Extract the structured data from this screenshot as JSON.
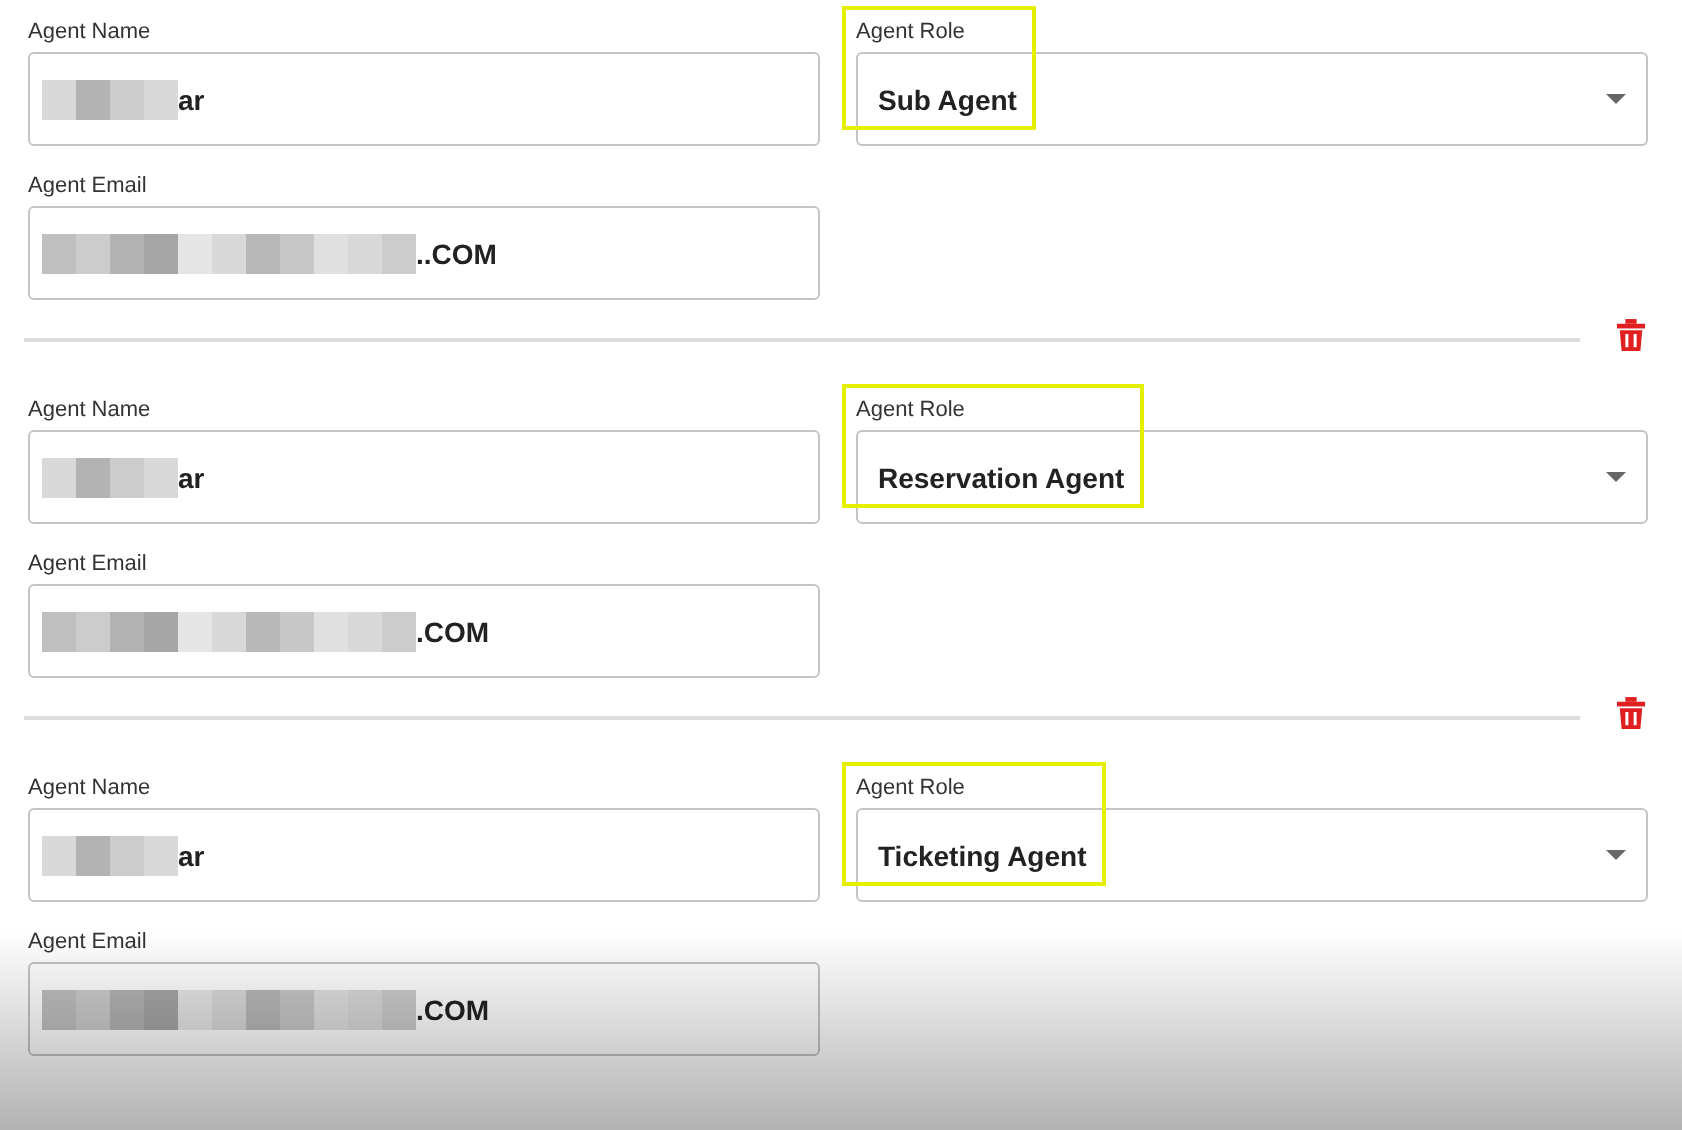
{
  "agents": [
    {
      "name_label": "Agent Name",
      "name_value": "ar",
      "role_label": "Agent Role",
      "role_value": "Sub Agent",
      "role_highlighted": true,
      "email_label": "Agent Email",
      "email_value": "..COM"
    },
    {
      "name_label": "Agent Name",
      "name_value": "ar",
      "role_label": "Agent Role",
      "role_value": "Reservation Agent",
      "role_highlighted": true,
      "email_label": "Agent Email",
      "email_value": ".COM"
    },
    {
      "name_label": "Agent Name",
      "name_value": "ar",
      "role_label": "Agent Role",
      "role_value": "Ticketing Agent",
      "role_highlighted": true,
      "email_label": "Agent Email",
      "email_value": ".COM"
    }
  ]
}
